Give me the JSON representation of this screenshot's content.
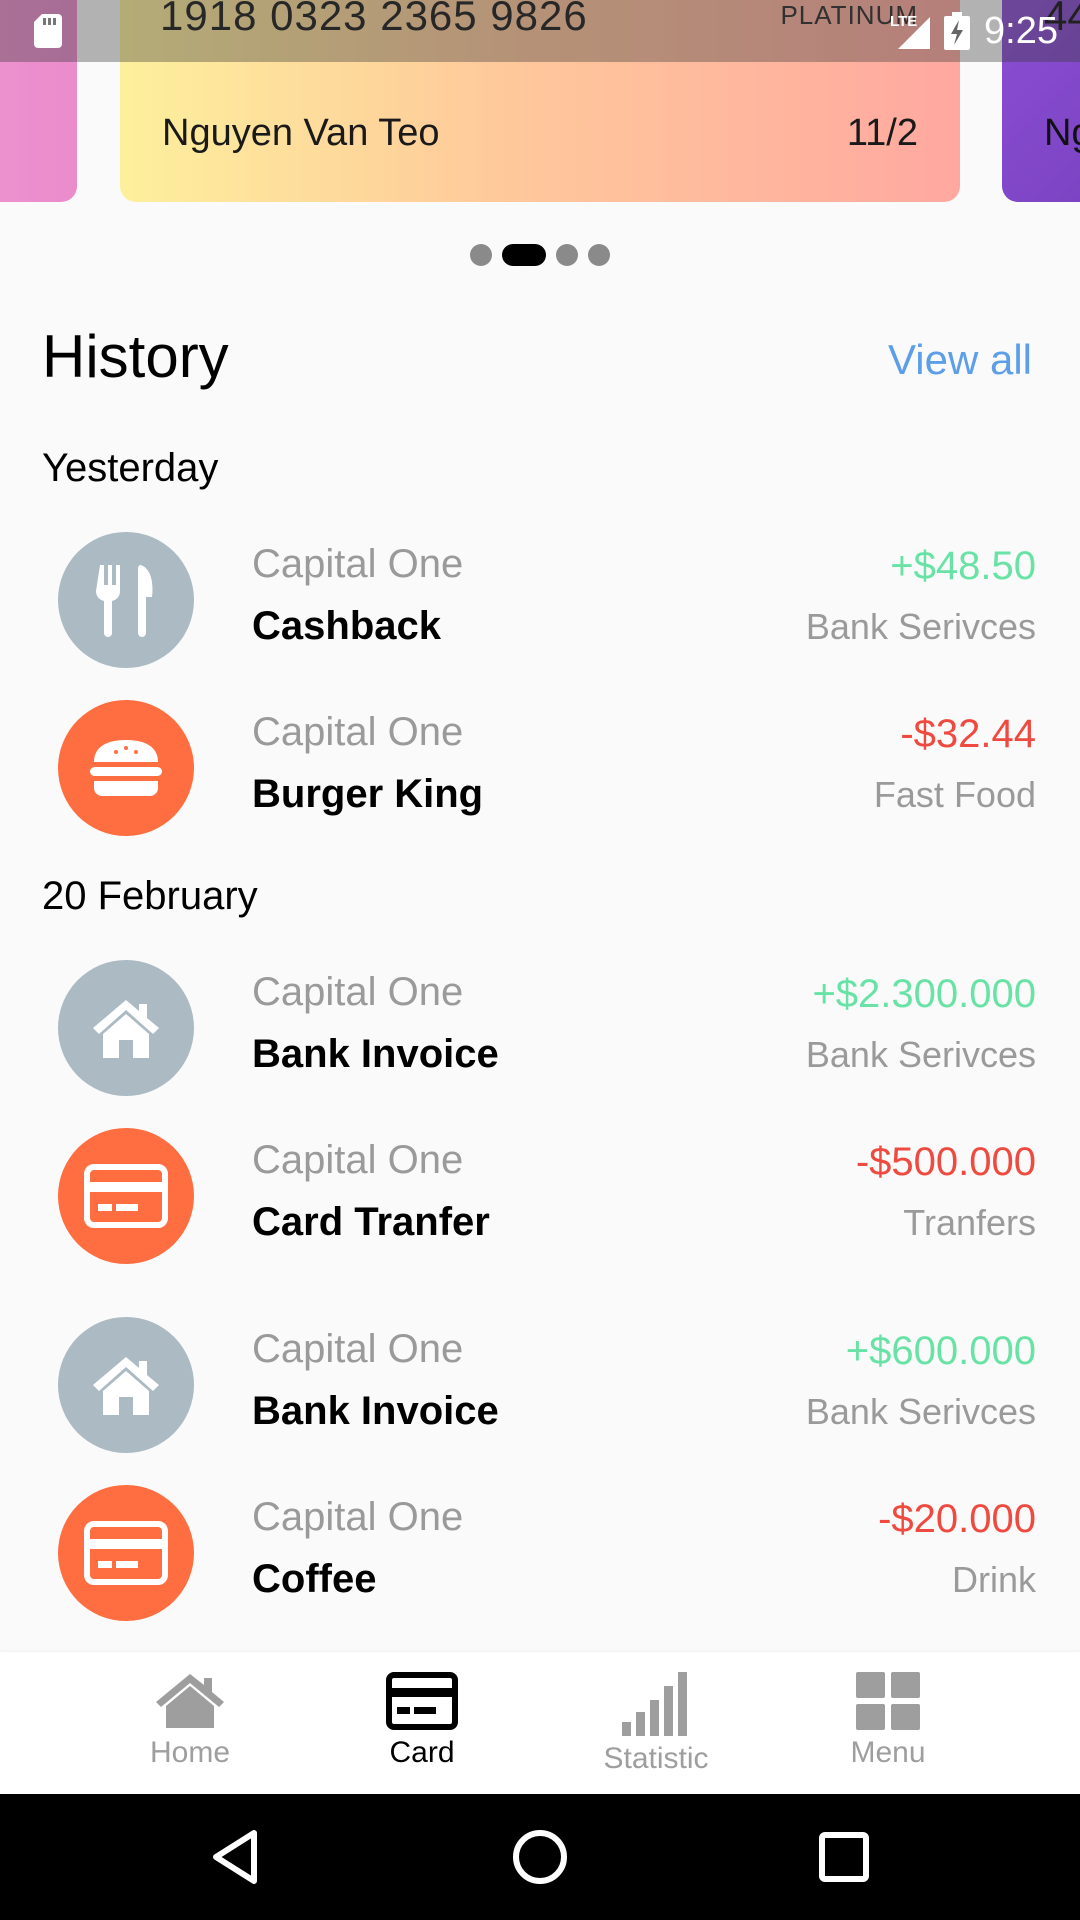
{
  "status_bar": {
    "time": "9:25",
    "network": "LTE",
    "icons": [
      "sd-card-icon",
      "signal-icon",
      "battery-charging-icon"
    ]
  },
  "cards": {
    "current": {
      "number": "1918 0323 2365 9826",
      "tier": "PLATINUM",
      "holder": "Nguyen Van Teo",
      "expiry": "11/2"
    },
    "next": {
      "number": "44",
      "holder": "Ng"
    }
  },
  "carousel": {
    "count": 4,
    "active_index": 1
  },
  "history": {
    "title": "History",
    "view_all": "View all",
    "groups": [
      {
        "label": "Yesterday",
        "items": [
          {
            "bank": "Capital One",
            "name": "Cashback",
            "amount": "+$48.50",
            "category": "Bank Serivces",
            "icon": "utensils-icon",
            "sign": "positive"
          },
          {
            "bank": "Capital One",
            "name": "Burger King",
            "amount": "-$32.44",
            "category": "Fast Food",
            "icon": "burger-icon",
            "sign": "negative"
          }
        ]
      },
      {
        "label": "20 February",
        "items": [
          {
            "bank": "Capital One",
            "name": "Bank Invoice",
            "amount": "+$2.300.000",
            "category": "Bank Serivces",
            "icon": "home-icon",
            "sign": "positive"
          },
          {
            "bank": "Capital One",
            "name": "Card Tranfer",
            "amount": "-$500.000",
            "category": "Tranfers",
            "icon": "credit-card-icon",
            "sign": "negative"
          },
          {
            "bank": "Capital One",
            "name": "Bank Invoice",
            "amount": "+$600.000",
            "category": "Bank Serivces",
            "icon": "home-icon",
            "sign": "positive"
          },
          {
            "bank": "Capital One",
            "name": "Coffee",
            "amount": "-$20.000",
            "category": "Drink",
            "icon": "credit-card-icon",
            "sign": "negative"
          }
        ]
      }
    ]
  },
  "bottom_nav": {
    "items": [
      {
        "label": "Home",
        "icon": "home-icon"
      },
      {
        "label": "Card",
        "icon": "credit-card-icon",
        "active": true
      },
      {
        "label": "Statistic",
        "icon": "bar-chart-icon"
      },
      {
        "label": "Menu",
        "icon": "grid-icon"
      }
    ]
  },
  "system_nav": {
    "icons": [
      "back-icon",
      "home-circle-icon",
      "recents-icon"
    ]
  },
  "colors": {
    "positive": "#69e3a5",
    "negative": "#ef4a3f",
    "link": "#5c9fe8",
    "icon_grey": "#abbac3",
    "icon_orange": "#ff6e40"
  }
}
